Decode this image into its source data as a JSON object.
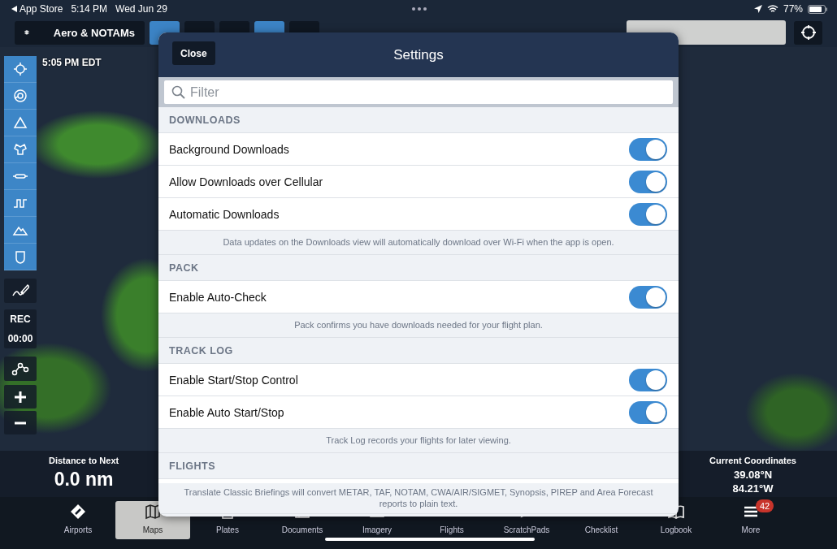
{
  "status_bar": {
    "back_label": "App Store",
    "time": "5:14 PM",
    "date": "Wed Jun 29",
    "battery": "77%"
  },
  "toolbar": {
    "layers_label": "Aero & NOTAMs"
  },
  "map": {
    "timestamp": "5:05 PM EDT",
    "record": {
      "label": "REC",
      "time": "00:00"
    },
    "distance": {
      "label": "Distance to Next",
      "value": "0.0 nm"
    },
    "coordinates": {
      "label": "Current Coordinates",
      "latitude": "39.08°N",
      "longitude": "84.21°W"
    }
  },
  "tabs": [
    {
      "label": "Airports",
      "selected": false
    },
    {
      "label": "Maps",
      "selected": true
    },
    {
      "label": "Plates",
      "selected": false
    },
    {
      "label": "Documents",
      "selected": false
    },
    {
      "label": "Imagery",
      "selected": false
    },
    {
      "label": "Flights",
      "selected": false
    },
    {
      "label": "ScratchPads",
      "selected": false
    },
    {
      "label": "Checklist",
      "selected": false
    },
    {
      "label": "Logbook",
      "selected": false
    },
    {
      "label": "More",
      "selected": false,
      "badge": "42"
    }
  ],
  "settings": {
    "close_label": "Close",
    "title": "Settings",
    "filter_placeholder": "Filter",
    "sections": [
      {
        "header": "DOWNLOADS",
        "rows": [
          {
            "label": "Background Downloads",
            "on": true
          },
          {
            "label": "Allow Downloads over Cellular",
            "on": true
          },
          {
            "label": "Automatic Downloads",
            "on": true
          }
        ],
        "footer": "Data updates on the Downloads view will automatically download over Wi-Fi when the app is open."
      },
      {
        "header": "PACK",
        "rows": [
          {
            "label": "Enable Auto-Check",
            "on": true
          }
        ],
        "footer": "Pack confirms you have downloads needed for your flight plan."
      },
      {
        "header": "TRACK LOG",
        "rows": [
          {
            "label": "Enable Start/Stop Control",
            "on": true
          },
          {
            "label": "Enable Auto Start/Stop",
            "on": true
          }
        ],
        "footer": "Track Log records your flights for later viewing."
      },
      {
        "header": "FLIGHTS",
        "footer": "Translate Classic Briefings will convert METAR, TAF, NOTAM, CWA/AIR/SIGMET, Synopsis, PIREP and Area Forecast reports to plain text."
      }
    ]
  }
}
